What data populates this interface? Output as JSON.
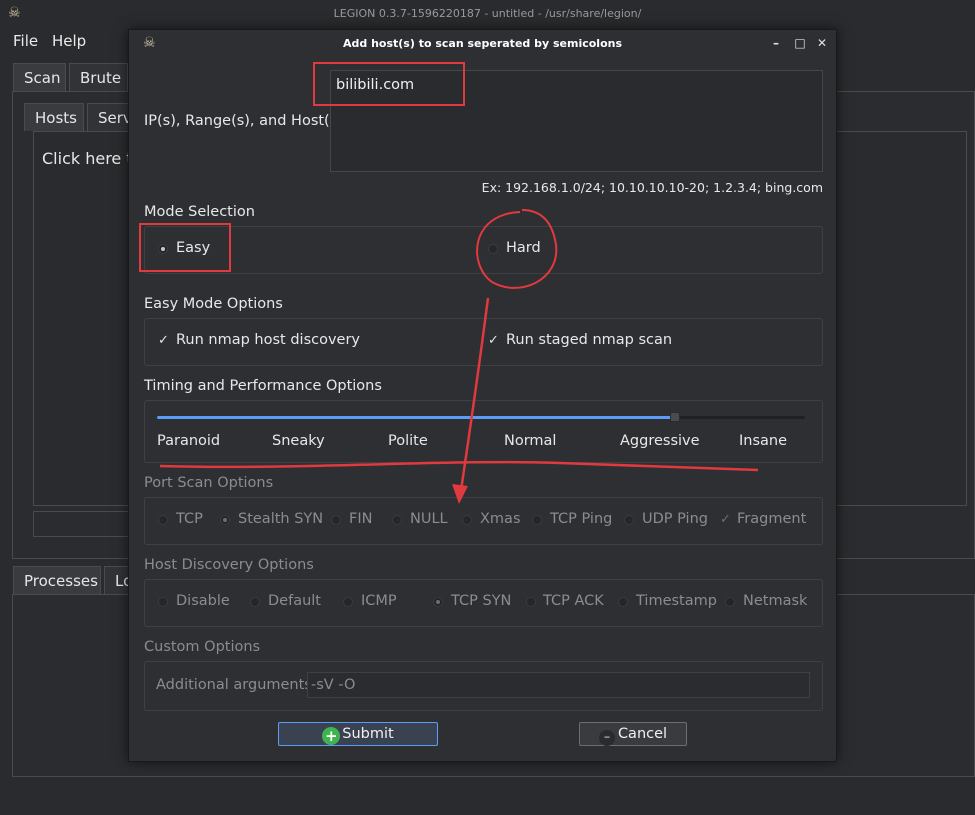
{
  "window": {
    "title": "LEGION 0.3.7-1596220187 - untitled - /usr/share/legion/"
  },
  "menu": [
    "File",
    "Help"
  ],
  "main_tabs": [
    "Scan",
    "Brute"
  ],
  "sub_tabs": [
    "Hosts",
    "Serv"
  ],
  "hosts_panel": {
    "placeholder_text": "Click here t"
  },
  "bottom_tabs": [
    "Processes",
    "Lo"
  ],
  "dialog": {
    "title": "Add host(s) to scan seperated by semicolons",
    "controls": {
      "minimize": "–",
      "maximize": "□",
      "close": "✕"
    },
    "hosts_label": "IP(s), Range(s), and Host(s)",
    "hosts_value": "bilibili.com",
    "example": "Ex: 192.168.1.0/24; 10.10.10.10-20; 1.2.3.4; bing.com",
    "mode_selection": {
      "title": "Mode Selection",
      "easy": "Easy",
      "hard": "Hard",
      "selected": "Easy"
    },
    "easy_mode": {
      "title": "Easy Mode Options",
      "host_discovery": "Run nmap host discovery",
      "staged_scan": "Run staged nmap scan",
      "check_mark": "✓"
    },
    "timing": {
      "title": "Timing and Performance Options",
      "levels": [
        "Paranoid",
        "Sneaky",
        "Polite",
        "Normal",
        "Aggressive",
        "Insane"
      ],
      "selected": "Aggressive",
      "slider_fraction": 0.8
    },
    "port_scan": {
      "title": "Port Scan Options",
      "options": [
        "TCP",
        "Stealth SYN",
        "FIN",
        "NULL",
        "Xmas",
        "TCP Ping",
        "UDP Ping",
        "Fragment"
      ],
      "selected": "Stealth SYN",
      "checked": "Fragment"
    },
    "host_discovery": {
      "title": "Host Discovery Options",
      "options": [
        "Disable",
        "Default",
        "ICMP",
        "TCP SYN",
        "TCP ACK",
        "Timestamp",
        "Netmask"
      ],
      "selected": "TCP SYN"
    },
    "custom": {
      "title": "Custom Options",
      "arg_label": "Additional arguments",
      "arg_value": "-sV -O"
    },
    "submit": "Submit",
    "cancel": "Cancel"
  },
  "colors": {
    "accent": "#5a9cf8",
    "annotation": "#e0393e",
    "submit_icon": "#3fb34f"
  }
}
